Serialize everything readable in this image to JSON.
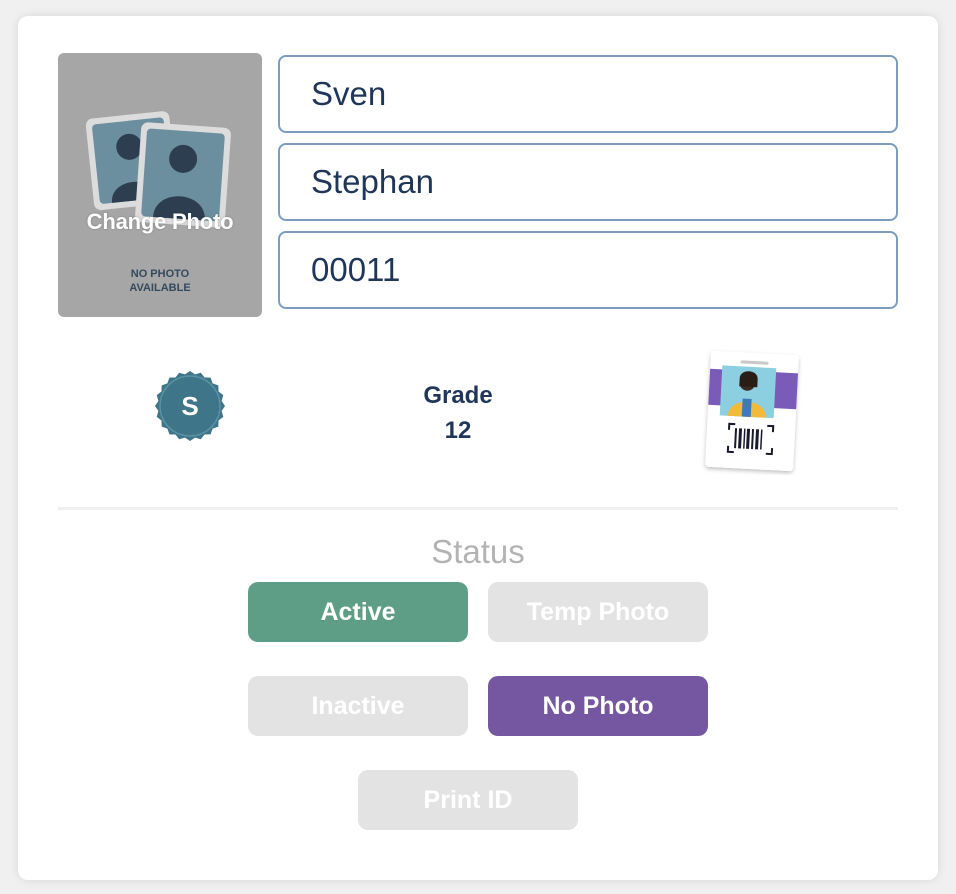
{
  "photo": {
    "overlay_label": "Change Photo",
    "placeholder_line1": "NO PHOTO",
    "placeholder_line2": "AVAILABLE",
    "icon": "no-photo-placeholder-icon"
  },
  "fields": {
    "first_name": "Sven",
    "last_name": "Stephan",
    "student_id": "00011"
  },
  "badge": {
    "letter": "S",
    "color": "#3e7589",
    "icon": "badge-icon"
  },
  "grade": {
    "label": "Grade",
    "value": "12"
  },
  "id_card": {
    "icon": "id-card-icon"
  },
  "status": {
    "label": "Status",
    "buttons": {
      "active": "Active",
      "temp_photo": "Temp Photo",
      "inactive": "Inactive",
      "no_photo": "No Photo",
      "print_id": "Print ID"
    },
    "selected": [
      "Active",
      "No Photo"
    ]
  },
  "colors": {
    "field_border": "#7c9cc0",
    "text_dark": "#1f3658",
    "active_green": "#5e9e86",
    "no_photo_purple": "#7457a0",
    "disabled_gray": "#e3e3e3"
  }
}
